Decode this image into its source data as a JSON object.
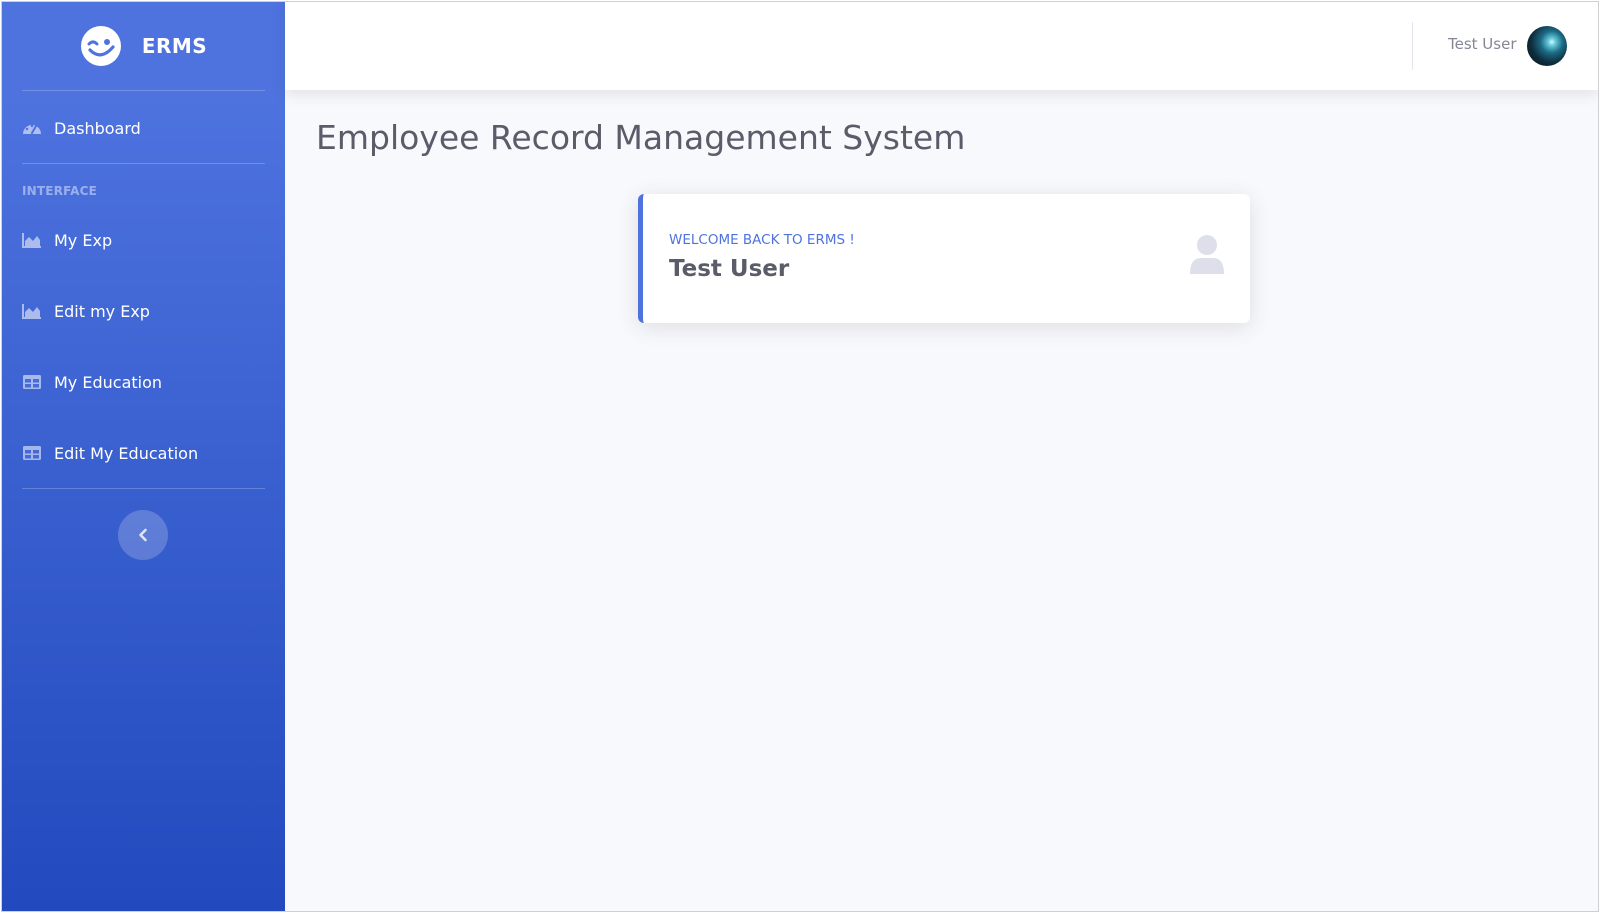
{
  "brand": {
    "name": "ERMS",
    "icon": "wink-face-icon"
  },
  "sidebar": {
    "items": [
      {
        "label": "Dashboard",
        "icon": "tachometer-icon"
      },
      {
        "label": "My Exp",
        "icon": "area-chart-icon"
      },
      {
        "label": "Edit my Exp",
        "icon": "area-chart-icon"
      },
      {
        "label": "My Education",
        "icon": "table-icon"
      },
      {
        "label": "Edit My Education",
        "icon": "table-icon"
      }
    ],
    "section_heading": "INTERFACE",
    "toggle_icon": "chevron-left-icon"
  },
  "topbar": {
    "user_name": "Test User",
    "avatar_icon": "user-avatar"
  },
  "main": {
    "page_title": "Employee Record Management System",
    "card": {
      "label": "WELCOME BACK TO ERMS !",
      "value": "Test User",
      "icon": "user-icon",
      "accent_color": "#4e73df"
    }
  },
  "colors": {
    "sidebar_top": "#4e73df",
    "sidebar_bottom": "#224abe",
    "text_muted": "#858796",
    "text_dark": "#5a5c69",
    "background": "#f8f9fc"
  }
}
